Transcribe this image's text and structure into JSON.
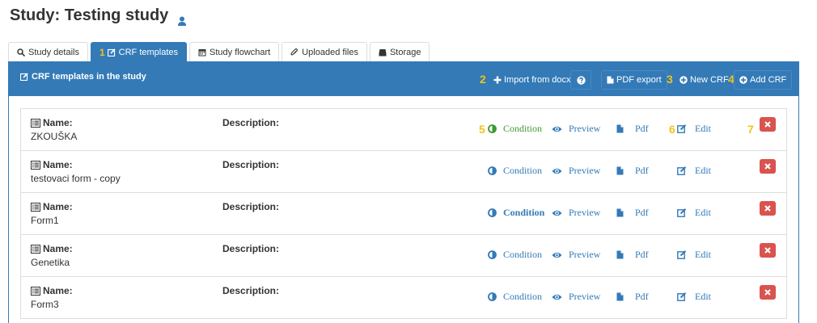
{
  "page": {
    "title": "Study: Testing study"
  },
  "tabs": [
    {
      "label": "Study details"
    },
    {
      "label": "CRF templates",
      "marker": "1"
    },
    {
      "label": "Study flowchart"
    },
    {
      "label": "Uploaded files"
    },
    {
      "label": "Storage"
    }
  ],
  "panel": {
    "title": "CRF templates in the study",
    "import_marker": "2",
    "import_label": "Import from docx",
    "pdf_export_label": "PDF export",
    "new_crf_marker": "3",
    "new_crf_label": "New CRF",
    "add_crf_marker": "4",
    "add_crf_label": "Add CRF"
  },
  "labels": {
    "name": "Name:",
    "description": "Description:",
    "condition": "Condition",
    "preview": "Preview",
    "pdf": "Pdf",
    "edit": "Edit"
  },
  "row_markers": {
    "condition": "5",
    "edit": "6",
    "delete": "7"
  },
  "rows": [
    {
      "name": "ZKOUŠKA"
    },
    {
      "name": "testovaci form - copy"
    },
    {
      "name": "Form1"
    },
    {
      "name": "Genetika"
    },
    {
      "name": "Form3"
    }
  ],
  "colors": {
    "primary": "#337ab7",
    "danger": "#d9534f",
    "condition_active": "#3c9a2e",
    "marker": "#f0c419"
  }
}
